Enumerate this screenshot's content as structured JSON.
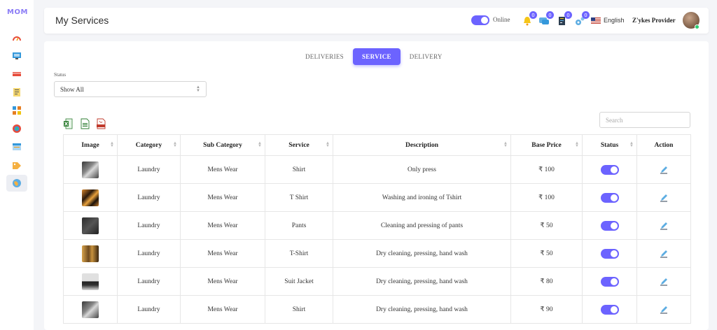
{
  "sidebar": {
    "logo": "MOM",
    "items": [
      {
        "name": "dashboard",
        "icon": "gauge-icon",
        "active": false
      },
      {
        "name": "monitor",
        "icon": "monitor-icon",
        "active": false
      },
      {
        "name": "cards",
        "icon": "card-icon",
        "active": false
      },
      {
        "name": "orders",
        "icon": "receipt-icon",
        "active": false
      },
      {
        "name": "catalog",
        "icon": "grid-icon",
        "active": false
      },
      {
        "name": "globe",
        "icon": "globe-icon",
        "active": false
      },
      {
        "name": "schedule",
        "icon": "calendar-icon",
        "active": false
      },
      {
        "name": "offers",
        "icon": "tag-icon",
        "active": false
      },
      {
        "name": "services",
        "icon": "earth-icon",
        "active": true
      }
    ]
  },
  "header": {
    "title": "My Services",
    "online_label": "Online",
    "notifications": [
      {
        "icon": "bell-icon",
        "count": "0"
      },
      {
        "icon": "chat-icon",
        "count": "0"
      },
      {
        "icon": "document-icon",
        "count": "0"
      },
      {
        "icon": "gear-icon",
        "count": "0"
      }
    ],
    "language": "English",
    "user_name": "Z'ykes Provider"
  },
  "tabs": [
    {
      "label": "DELIVERIES",
      "active": false
    },
    {
      "label": "SERVICE",
      "active": true
    },
    {
      "label": "DELIVERY",
      "active": false
    }
  ],
  "filter": {
    "status_label": "Status",
    "status_value": "Show All"
  },
  "search": {
    "placeholder": "Search"
  },
  "table": {
    "columns": [
      "Image",
      "Category",
      "Sub Category",
      "Service",
      "Description",
      "Base Price",
      "Status",
      "Action"
    ],
    "rows": [
      {
        "category": "Laundry",
        "sub_category": "Mens Wear",
        "service": "Shirt",
        "description": "Only press",
        "price": "₹ 100"
      },
      {
        "category": "Laundry",
        "sub_category": "Mens Wear",
        "service": "T Shirt",
        "description": "Washing and ironing of Tshirt",
        "price": "₹ 100"
      },
      {
        "category": "Laundry",
        "sub_category": "Mens Wear",
        "service": "Pants",
        "description": "Cleaning and pressing of pants",
        "price": "₹ 50"
      },
      {
        "category": "Laundry",
        "sub_category": "Mens Wear",
        "service": "T-Shirt",
        "description": "Dry cleaning, pressing, hand wash",
        "price": "₹ 50"
      },
      {
        "category": "Laundry",
        "sub_category": "Mens Wear",
        "service": "Suit Jacket",
        "description": "Dry cleaning, pressing, hand wash",
        "price": "₹ 80"
      },
      {
        "category": "Laundry",
        "sub_category": "Mens Wear",
        "service": "Shirt",
        "description": "Dry cleaning, pressing, hand wash",
        "price": "₹ 90"
      }
    ]
  },
  "colors": {
    "accent": "#6c63ff",
    "online": "#2ecc71"
  }
}
